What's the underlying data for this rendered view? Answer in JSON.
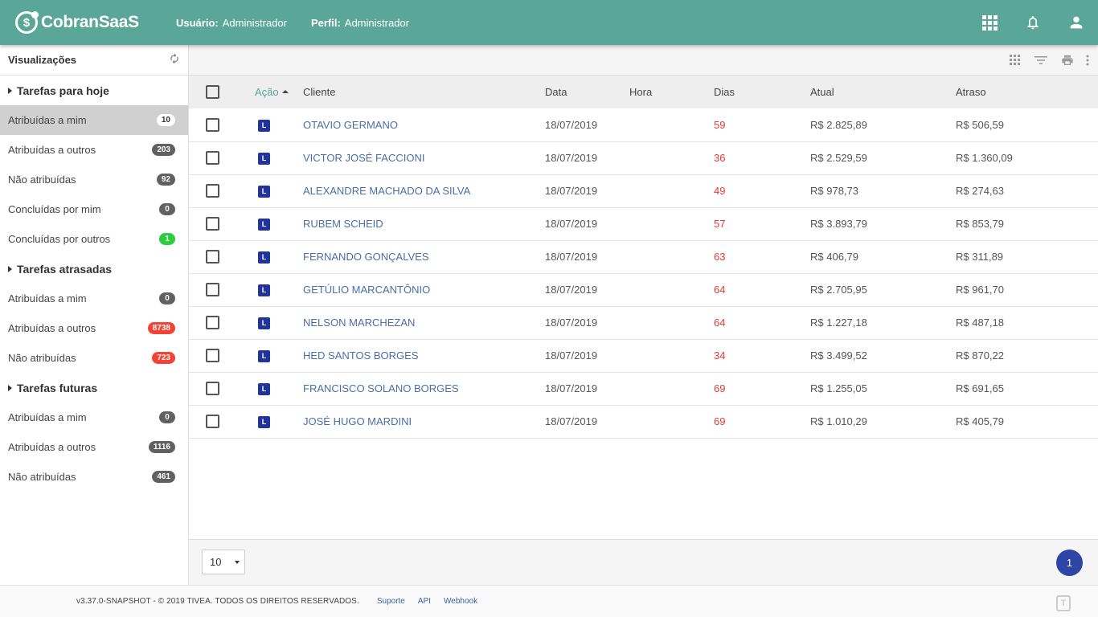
{
  "header": {
    "logo_symbol": "$",
    "logo_text": "CobranSaaS",
    "user_label": "Usuário:",
    "user_value": "Administrador",
    "profile_label": "Perfil:",
    "profile_value": "Administrador",
    "icons": [
      "apps-grid-icon",
      "bell-icon",
      "user-icon"
    ],
    "color": "#5aa799"
  },
  "sidebar": {
    "title": "Visualizações",
    "refresh_icon": "refresh-icon",
    "sections": [
      {
        "title": "Tarefas para hoje",
        "items": [
          {
            "label": "Atribuídas a mim",
            "count": "10",
            "active": true,
            "badge": "white"
          },
          {
            "label": "Atribuídas a outros",
            "count": "203",
            "badge": "gray"
          },
          {
            "label": "Não atribuídas",
            "count": "92",
            "badge": "gray"
          },
          {
            "label": "Concluídas por mim",
            "count": "0",
            "badge": "gray"
          },
          {
            "label": "Concluídas por outros",
            "count": "1",
            "badge": "green"
          }
        ]
      },
      {
        "title": "Tarefas atrasadas",
        "items": [
          {
            "label": "Atribuídas a mim",
            "count": "0",
            "badge": "gray"
          },
          {
            "label": "Atribuídas a outros",
            "count": "8738",
            "badge": "red"
          },
          {
            "label": "Não atribuídas",
            "count": "723",
            "badge": "red"
          }
        ]
      },
      {
        "title": "Tarefas futuras",
        "items": [
          {
            "label": "Atribuídas a mim",
            "count": "0",
            "badge": "gray"
          },
          {
            "label": "Atribuídas a outros",
            "count": "1116",
            "badge": "gray"
          },
          {
            "label": "Não atribuídas",
            "count": "461",
            "badge": "gray"
          }
        ]
      }
    ]
  },
  "toolbar": {
    "icons": [
      "columns-grid-icon",
      "filter-icon",
      "print-icon",
      "more-vert-icon"
    ]
  },
  "table": {
    "columns": {
      "acao": "Ação",
      "cliente": "Cliente",
      "data": "Data",
      "hora": "Hora",
      "dias": "Dias",
      "atual": "Atual",
      "atraso": "Atraso"
    },
    "rows": [
      {
        "tag": "L",
        "cliente": "OTAVIO GERMANO",
        "data": "18/07/2019",
        "hora": "",
        "dias": "59",
        "atual": "R$ 2.825,89",
        "atraso": "R$ 506,59"
      },
      {
        "tag": "L",
        "cliente": "VICTOR JOSÉ FACCIONI",
        "data": "18/07/2019",
        "hora": "",
        "dias": "36",
        "atual": "R$ 2.529,59",
        "atraso": "R$ 1.360,09"
      },
      {
        "tag": "L",
        "cliente": "ALEXANDRE MACHADO DA SILVA",
        "data": "18/07/2019",
        "hora": "",
        "dias": "49",
        "atual": "R$ 978,73",
        "atraso": "R$ 274,63"
      },
      {
        "tag": "L",
        "cliente": "RUBEM SCHEID",
        "data": "18/07/2019",
        "hora": "",
        "dias": "57",
        "atual": "R$ 3.893,79",
        "atraso": "R$ 853,79"
      },
      {
        "tag": "L",
        "cliente": "FERNANDO GONÇALVES",
        "data": "18/07/2019",
        "hora": "",
        "dias": "63",
        "atual": "R$ 406,79",
        "atraso": "R$ 311,89"
      },
      {
        "tag": "L",
        "cliente": "GETÚLIO MARCANTÔNIO",
        "data": "18/07/2019",
        "hora": "",
        "dias": "64",
        "atual": "R$ 2.705,95",
        "atraso": "R$ 961,70"
      },
      {
        "tag": "L",
        "cliente": "NELSON MARCHEZAN",
        "data": "18/07/2019",
        "hora": "",
        "dias": "64",
        "atual": "R$ 1.227,18",
        "atraso": "R$ 487,18"
      },
      {
        "tag": "L",
        "cliente": "HED SANTOS BORGES",
        "data": "18/07/2019",
        "hora": "",
        "dias": "34",
        "atual": "R$ 3.499,52",
        "atraso": "R$ 870,22"
      },
      {
        "tag": "L",
        "cliente": "FRANCISCO SOLANO BORGES",
        "data": "18/07/2019",
        "hora": "",
        "dias": "69",
        "atual": "R$ 1.255,05",
        "atraso": "R$ 691,65"
      },
      {
        "tag": "L",
        "cliente": "JOSÉ HUGO MARDINI",
        "data": "18/07/2019",
        "hora": "",
        "dias": "69",
        "atual": "R$ 1.010,29",
        "atraso": "R$ 405,79"
      }
    ]
  },
  "pagination": {
    "page_size": "10",
    "current_page": "1"
  },
  "footer": {
    "copyright": "v3.37.0-SNAPSHOT - © 2019 TIVEA. TODOS OS DIREITOS RESERVADOS.",
    "links": [
      "Suporte",
      "API",
      "Webhook"
    ],
    "logo_letter": "T"
  }
}
